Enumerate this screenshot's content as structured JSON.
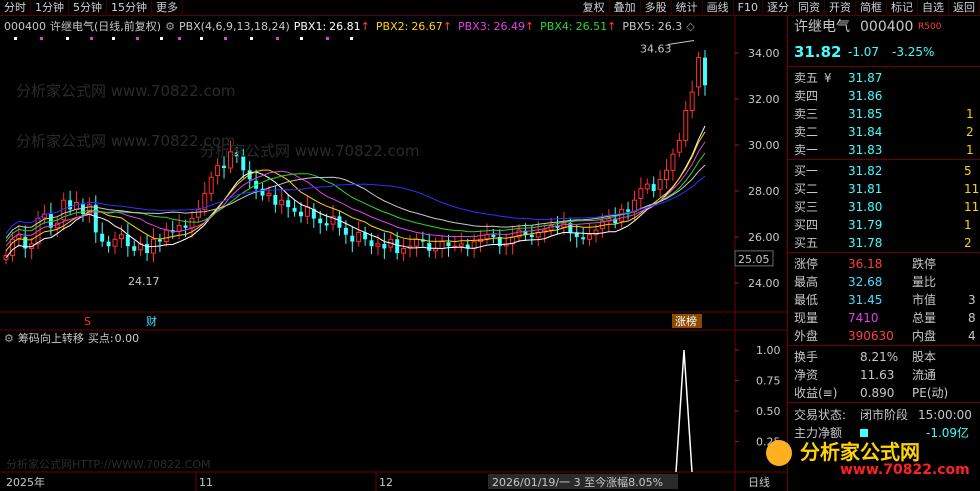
{
  "toolbar": {
    "left": [
      "分时",
      "1分钟",
      "5分钟",
      "15分钟",
      "更多"
    ],
    "right": [
      "复权",
      "叠加",
      "多股",
      "统计",
      "画线",
      "F10",
      "逐分",
      "同资",
      "开资",
      "简框",
      "标记",
      "自选",
      "返回"
    ]
  },
  "stock": {
    "code": "000400",
    "name": "许继电气",
    "period": "(日线,前复权)"
  },
  "indicator": {
    "name": "PBX(4,6,9,13,18,24)",
    "lines": [
      {
        "label": "PBX1:",
        "value": "26.81",
        "color": "#ffffff"
      },
      {
        "label": "PBX2:",
        "value": "26.67",
        "color": "#ffd400"
      },
      {
        "label": "PBX3:",
        "value": "26.49",
        "color": "#e040e0"
      },
      {
        "label": "PBX4:",
        "value": "26.51",
        "color": "#2bd82b"
      },
      {
        "label": "PBX5:",
        "value": "26.3",
        "color": "#c8c8c8"
      }
    ]
  },
  "y_axis": [
    "34.00",
    "32.00",
    "30.00",
    "28.00",
    "26.00",
    "24.00"
  ],
  "last_price_tag": "25.05",
  "annotations": {
    "high": "34.63",
    "low": "24.17",
    "tag_s": "S",
    "tag_cai": "财",
    "tag_zhangbang": "涨榜"
  },
  "lower": {
    "name": "筹码向上转移",
    "buy_label": "买点:",
    "buy_value": "0.00",
    "y_axis": [
      "1.00",
      "0.75",
      "0.50",
      "0.25"
    ],
    "spike_value": 1.0
  },
  "x_axis": {
    "year": "2025年",
    "m11": "11",
    "m12": "12",
    "status": "2026/01/19/一 3 至今涨幅8.05%",
    "right": "日线"
  },
  "watermarks": {
    "site": "分析家公式网 www.70822.com",
    "http": "分析家公式网HTTP://WWW.70822.COM"
  },
  "quote": {
    "name": "许继电气",
    "code": "000400",
    "badge": "R500",
    "price": "31.82",
    "change": "-1.07",
    "pct": "-3.25%",
    "asks": [
      {
        "label": "卖五",
        "flag": "¥",
        "price": "31.87",
        "vol": ""
      },
      {
        "label": "卖四",
        "flag": "",
        "price": "31.86",
        "vol": ""
      },
      {
        "label": "卖三",
        "flag": "",
        "price": "31.85",
        "vol": "1"
      },
      {
        "label": "卖二",
        "flag": "",
        "price": "31.84",
        "vol": "2"
      },
      {
        "label": "卖一",
        "flag": "",
        "price": "31.83",
        "vol": "1"
      }
    ],
    "bids": [
      {
        "label": "买一",
        "price": "31.82",
        "vol": "5"
      },
      {
        "label": "买二",
        "price": "31.81",
        "vol": "11"
      },
      {
        "label": "买三",
        "price": "31.80",
        "vol": "11"
      },
      {
        "label": "买四",
        "price": "31.79",
        "vol": "1"
      },
      {
        "label": "买五",
        "price": "31.78",
        "vol": "2"
      }
    ],
    "stats": [
      {
        "l1": "涨停",
        "v1": "36.18",
        "c1": "#ff4040",
        "l2": "跌停",
        "v2": ""
      },
      {
        "l1": "最高",
        "v1": "32.68",
        "c1": "#40e0ff",
        "l2": "量比",
        "v2": ""
      },
      {
        "l1": "最低",
        "v1": "31.45",
        "c1": "#40e0ff",
        "l2": "市值",
        "v2": "3"
      },
      {
        "l1": "现量",
        "v1": "7410",
        "c1": "#e040e0",
        "l2": "总量",
        "v2": "8"
      },
      {
        "l1": "外盘",
        "v1": "390630",
        "c1": "#ff4040",
        "l2": "内盘",
        "v2": "4"
      }
    ],
    "stats2": [
      {
        "l1": "换手",
        "v1": "8.21%",
        "l2": "股本"
      },
      {
        "l1": "净资",
        "v1": "11.63",
        "l2": "流通"
      },
      {
        "l1": "收益(≡)",
        "v1": "0.890",
        "l2": "PE(动)"
      }
    ],
    "trade_state_label": "交易状态:",
    "trade_state": "闭市阶段",
    "trade_time": "15:00:00",
    "main_flow_label": "主力净额",
    "main_flow": "-1.09亿"
  },
  "logo": {
    "text": "分析家公式网",
    "url": "www.70822.com"
  }
}
